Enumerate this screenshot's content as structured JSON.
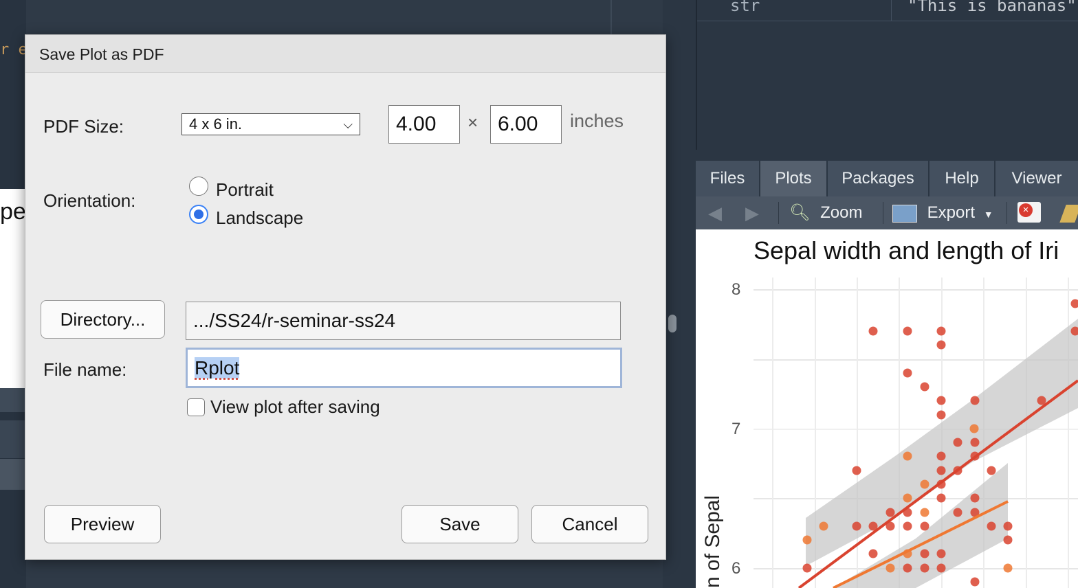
{
  "background": {
    "editor_fragment": "r e",
    "plot_fragment": "pe"
  },
  "env_pane": {
    "row": {
      "name": "str",
      "value": "\"This is bananas\""
    }
  },
  "pane_tabs": [
    "Files",
    "Plots",
    "Packages",
    "Help",
    "Viewer"
  ],
  "active_tab": "Plots",
  "plot_toolbar": {
    "zoom_label": "Zoom",
    "export_label": "Export"
  },
  "plot": {
    "title": "Sepal width and length of Iri",
    "y_label": "n of Sepal",
    "y_ticks": [
      "8",
      "7",
      "6"
    ],
    "colors": {
      "series_red": "#d9432f",
      "series_orange": "#ef7832",
      "ribbon": "#c4c4c4"
    }
  },
  "dialog": {
    "title": "Save Plot as PDF",
    "pdf_size_label": "PDF Size:",
    "pdf_size_value": "4 x 6 in.",
    "width_value": "4.00",
    "times_symbol": "×",
    "height_value": "6.00",
    "unit_label": "inches",
    "orientation_label": "Orientation:",
    "portrait_label": "Portrait",
    "landscape_label": "Landscape",
    "selected_orientation": "Landscape",
    "directory_button": "Directory...",
    "directory_value": ".../SS24/r-seminar-ss24",
    "file_name_label": "File name:",
    "file_name_value": "Rplot",
    "view_after_label": "View plot after saving",
    "preview_button": "Preview",
    "save_button": "Save",
    "cancel_button": "Cancel"
  }
}
